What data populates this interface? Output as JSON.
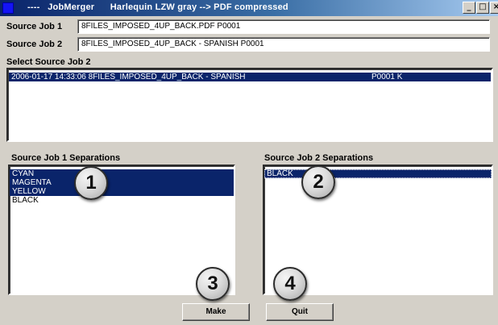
{
  "window": {
    "title": "----   JobMerger      Harlequin LZW gray --> PDF compressed",
    "controls": [
      "_",
      "□",
      "×"
    ]
  },
  "source_job_1": {
    "label": "Source Job 1",
    "value": "8FILES_IMPOSED_4UP_BACK.PDF P0001"
  },
  "source_job_2": {
    "label": "Source Job 2",
    "value": "8FILES_IMPOSED_4UP_BACK - SPANISH P0001"
  },
  "select_source_job_2": {
    "label": "Select Source Job 2",
    "rows": [
      {
        "text": "2006-01-17  14:33:06  8FILES_IMPOSED_4UP_BACK - SPANISH",
        "right": "P0001 K",
        "selected": true
      }
    ]
  },
  "separations_1": {
    "label": "Source Job 1 Separations",
    "items": [
      {
        "text": "CYAN",
        "selected": true
      },
      {
        "text": "MAGENTA",
        "selected": true
      },
      {
        "text": "YELLOW",
        "selected": true
      },
      {
        "text": "BLACK",
        "selected": false
      }
    ]
  },
  "separations_2": {
    "label": "Source Job 2 Separations",
    "items": [
      {
        "text": "BLACK",
        "selected": true
      }
    ]
  },
  "buttons": {
    "make": "Make",
    "quit": "Quit"
  },
  "callouts": {
    "c1": "1",
    "c2": "2",
    "c3": "3",
    "c4": "4"
  },
  "colors": {
    "selection": "#0a246a",
    "face": "#d4d0c8",
    "title_start": "#0a246a",
    "title_end": "#a6caf0",
    "app_icon": "#1414f5"
  }
}
